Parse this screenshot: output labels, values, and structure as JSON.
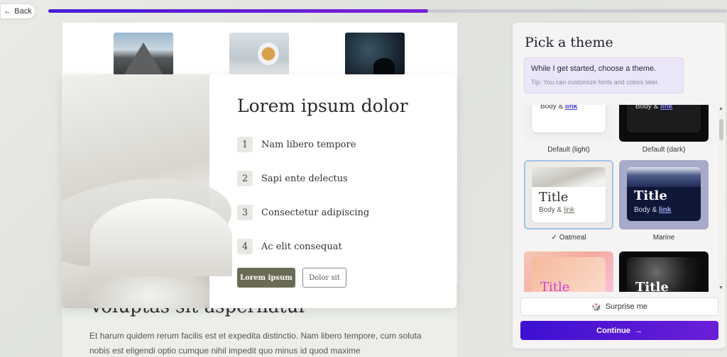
{
  "nav": {
    "back_label": "Back",
    "back_icon": "←"
  },
  "progress": {
    "fraction": 0.56,
    "color_start": "#4a1fd6",
    "color_end": "#7a1fd8"
  },
  "preview": {
    "card_title": "Lorem ipsum dolor",
    "list": [
      {
        "num": "1",
        "text": "Nam libero tempore"
      },
      {
        "num": "2",
        "text": "Sapi ente delectus"
      },
      {
        "num": "3",
        "text": "Consectetur adipiscing"
      },
      {
        "num": "4",
        "text": "Ac elit consequat"
      }
    ],
    "primary_button": "Lorem ipsum",
    "secondary_button": "Dolor sit",
    "section_heading": "Voluptas sit aspernatur",
    "paragraph": "Et harum quidem rerum facilis est et expedita distinctio. Nam libero tempore, cum soluta nobis est eligendi optio cumque nihil impedit quo minus id quod maxime"
  },
  "panel": {
    "title": "Pick a theme",
    "tip_main": "While I get started, choose a theme.",
    "tip_sub": "Tip: You can customize fonts and colors later.",
    "sample_title": "Title",
    "sample_body": "Body &",
    "sample_link": "link",
    "selected_check": "✓",
    "themes": [
      {
        "name": "Default (light)"
      },
      {
        "name": "Default (dark)"
      },
      {
        "name": "Oatmeal",
        "selected": true
      },
      {
        "name": "Marine"
      },
      {
        "name": ""
      },
      {
        "name": ""
      }
    ],
    "surprise_label": "Surprise me",
    "continue_label": "Continue",
    "continue_arrow": "→"
  }
}
